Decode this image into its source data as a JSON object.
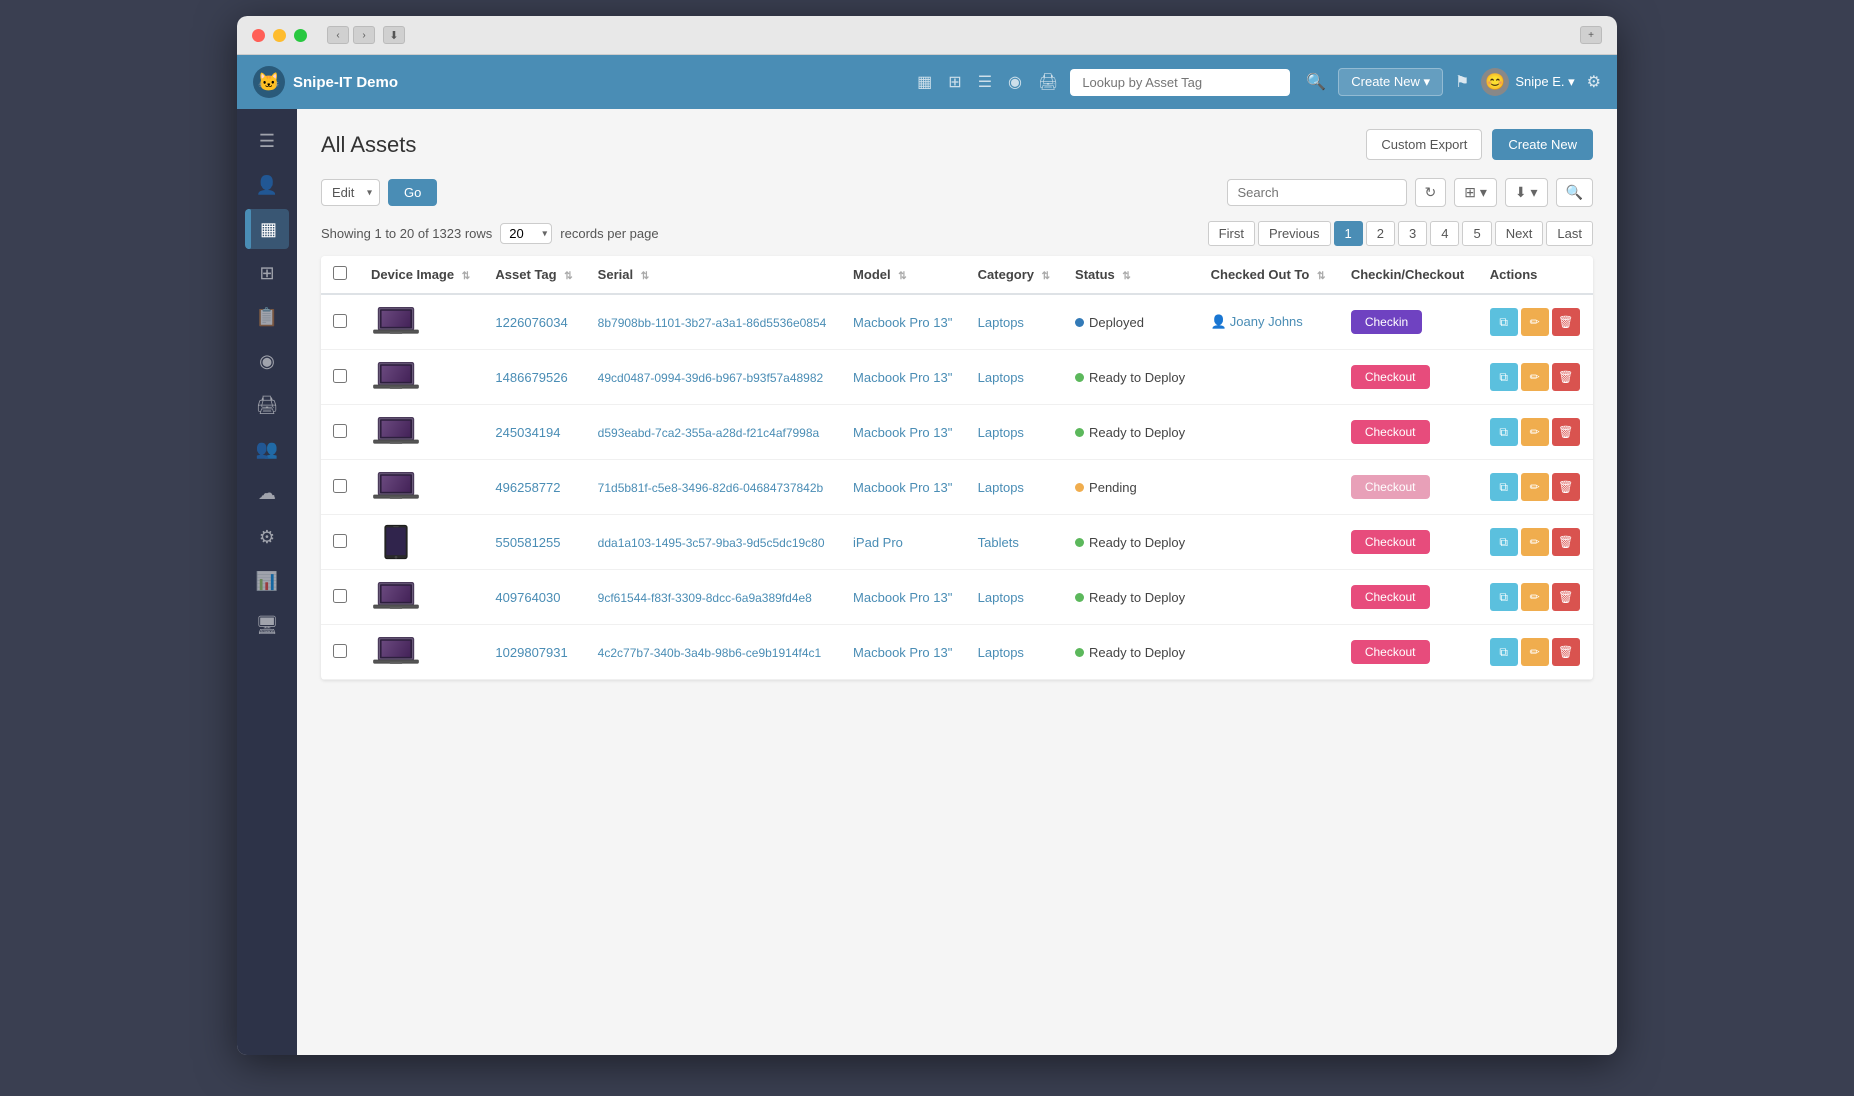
{
  "window": {
    "title": "Snipe-IT Demo"
  },
  "navbar": {
    "brand": "Snipe-IT Demo",
    "asset_tag_placeholder": "Lookup by Asset Tag",
    "create_new": "Create New ▾",
    "user_name": "Snipe E. ▾",
    "icons": [
      "▦",
      "⊞",
      "☰",
      "◉",
      "🖨"
    ]
  },
  "page": {
    "title": "All Assets",
    "custom_export_label": "Custom Export",
    "create_new_label": "Create New"
  },
  "toolbar": {
    "edit_label": "Edit",
    "go_label": "Go",
    "search_placeholder": "Search"
  },
  "pagination": {
    "showing_text": "Showing 1 to 20 of 1323 rows",
    "records_label": "records per page",
    "per_page_value": "20",
    "pages": [
      "First",
      "Previous",
      "1",
      "2",
      "3",
      "4",
      "5",
      "Next",
      "Last"
    ],
    "current_page": "1"
  },
  "table": {
    "columns": [
      "",
      "Device Image",
      "Asset Tag",
      "Serial",
      "Model",
      "Category",
      "Status",
      "Checked Out To",
      "Checkin/Checkout",
      "Actions"
    ],
    "rows": [
      {
        "id": 1,
        "asset_tag": "1226076034",
        "serial": "8b7908bb-1101-3b27-a3a1-86d5536e0854",
        "model": "Macbook Pro 13\"",
        "category": "Laptops",
        "status": "Deployed",
        "status_type": "deployed",
        "checked_out_to": "Joany Johns",
        "action_label": "Checkin",
        "action_type": "checkin",
        "device_type": "laptop"
      },
      {
        "id": 2,
        "asset_tag": "1486679526",
        "serial": "49cd0487-0994-39d6-b967-b93f57a48982",
        "model": "Macbook Pro 13\"",
        "category": "Laptops",
        "status": "Ready to Deploy",
        "status_type": "ready",
        "checked_out_to": "",
        "action_label": "Checkout",
        "action_type": "checkout",
        "device_type": "laptop"
      },
      {
        "id": 3,
        "asset_tag": "245034194",
        "serial": "d593eabd-7ca2-355a-a28d-f21c4af7998a",
        "model": "Macbook Pro 13\"",
        "category": "Laptops",
        "status": "Ready to Deploy",
        "status_type": "ready",
        "checked_out_to": "",
        "action_label": "Checkout",
        "action_type": "checkout",
        "device_type": "laptop"
      },
      {
        "id": 4,
        "asset_tag": "496258772",
        "serial": "71d5b81f-c5e8-3496-82d6-04684737842b",
        "model": "Macbook Pro 13\"",
        "category": "Laptops",
        "status": "Pending",
        "status_type": "pending",
        "checked_out_to": "",
        "action_label": "Checkout",
        "action_type": "checkout-muted",
        "device_type": "laptop"
      },
      {
        "id": 5,
        "asset_tag": "550581255",
        "serial": "dda1a103-1495-3c57-9ba3-9d5c5dc19c80",
        "model": "iPad Pro",
        "category": "Tablets",
        "status": "Ready to Deploy",
        "status_type": "ready",
        "checked_out_to": "",
        "action_label": "Checkout",
        "action_type": "checkout",
        "device_type": "tablet"
      },
      {
        "id": 6,
        "asset_tag": "409764030",
        "serial": "9cf61544-f83f-3309-8dcc-6a9a389fd4e8",
        "model": "Macbook Pro 13\"",
        "category": "Laptops",
        "status": "Ready to Deploy",
        "status_type": "ready",
        "checked_out_to": "",
        "action_label": "Checkout",
        "action_type": "checkout",
        "device_type": "laptop"
      },
      {
        "id": 7,
        "asset_tag": "1029807931",
        "serial": "4c2c77b7-340b-3a4b-98b6-ce9b1914f4c1",
        "model": "Macbook Pro 13\"",
        "category": "Laptops",
        "status": "Ready to Deploy",
        "status_type": "ready",
        "checked_out_to": "",
        "action_label": "Checkout",
        "action_type": "checkout",
        "device_type": "laptop"
      }
    ]
  },
  "sidebar": {
    "items": [
      {
        "icon": "☰",
        "name": "menu"
      },
      {
        "icon": "👤",
        "name": "dashboard"
      },
      {
        "icon": "▦",
        "name": "assets",
        "active": true
      },
      {
        "icon": "⊞",
        "name": "licenses"
      },
      {
        "icon": "📋",
        "name": "accessories"
      },
      {
        "icon": "◉",
        "name": "consumables"
      },
      {
        "icon": "🖨",
        "name": "components"
      },
      {
        "icon": "👥",
        "name": "users"
      },
      {
        "icon": "☁",
        "name": "uploads"
      },
      {
        "icon": "⚙",
        "name": "settings"
      },
      {
        "icon": "📊",
        "name": "reports"
      },
      {
        "icon": "🖥",
        "name": "display"
      }
    ]
  }
}
